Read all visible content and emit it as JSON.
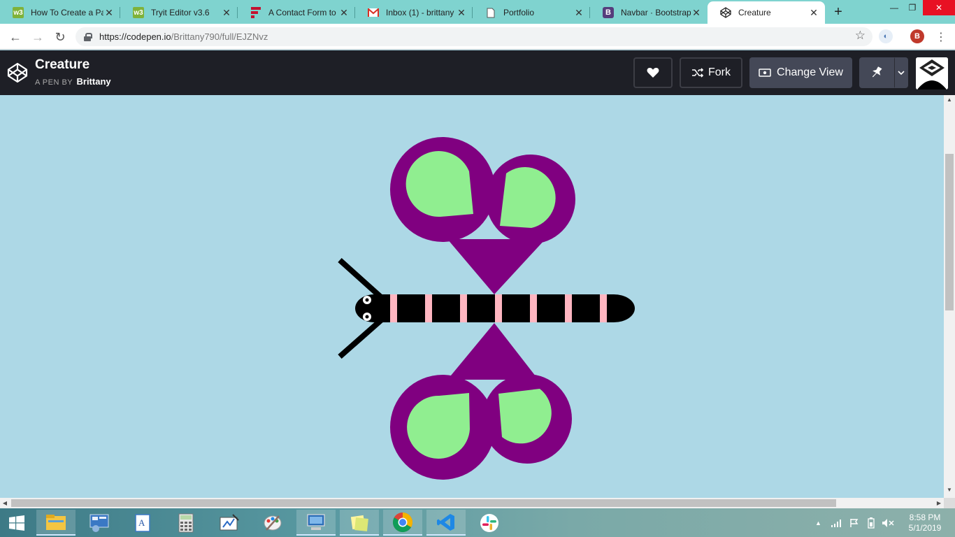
{
  "browser": {
    "tabs": [
      {
        "title": "How To Create a Pa",
        "icon": "w3schools-icon",
        "active": false
      },
      {
        "title": "Tryit Editor v3.6",
        "icon": "w3schools-icon",
        "active": false
      },
      {
        "title": "A Contact Form to",
        "icon": "formstack-icon",
        "active": false
      },
      {
        "title": "Inbox (1) - brittany",
        "icon": "gmail-icon",
        "active": false
      },
      {
        "title": "Portfolio",
        "icon": "document-icon",
        "active": false
      },
      {
        "title": "Navbar · Bootstrap",
        "icon": "bootstrap-icon",
        "active": false
      },
      {
        "title": "Creature",
        "icon": "codepen-icon",
        "active": true
      }
    ],
    "url_host": "https://codepen.io",
    "url_path": "/Brittany790/full/EJZNvz",
    "profile_initial": "B"
  },
  "codepen": {
    "pen_title": "Creature",
    "by_label": "A PEN BY",
    "author": "Brittany",
    "fork_label": "Fork",
    "change_view_label": "Change View"
  },
  "colors": {
    "background": "#add8e6",
    "wing": "#800080",
    "wing_spot": "#90ee90",
    "body": "#000000",
    "stripe": "#ffb6c1",
    "header": "#1e1f26"
  },
  "taskbar": {
    "apps": [
      "file-explorer-icon",
      "control-panel-icon",
      "wordpad-icon",
      "calculator-icon",
      "snipping-icon",
      "paint-icon",
      "remote-desktop-icon",
      "sticky-notes-icon",
      "chrome-icon",
      "vscode-icon",
      "slack-icon"
    ],
    "time": "8:58 PM",
    "date": "5/1/2019"
  }
}
